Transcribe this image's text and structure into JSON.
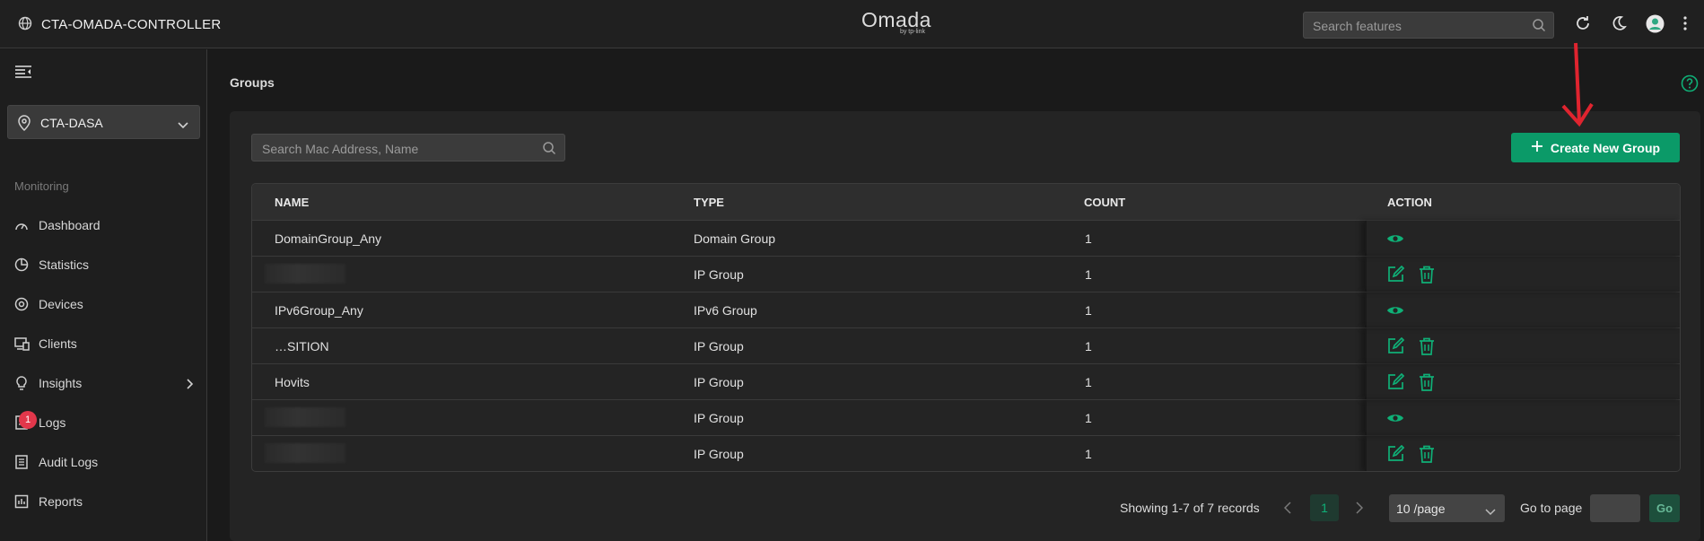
{
  "header": {
    "controller_name": "CTA-OMADA-CONTROLLER",
    "brand": "Omada",
    "brand_sub": "by tp-link",
    "search_placeholder": "Search features"
  },
  "sidebar": {
    "site": "CTA-DASA",
    "section": "Monitoring",
    "items": [
      {
        "label": "Dashboard",
        "icon": "dashboard-icon"
      },
      {
        "label": "Statistics",
        "icon": "pie-chart-icon"
      },
      {
        "label": "Devices",
        "icon": "devices-icon"
      },
      {
        "label": "Clients",
        "icon": "clients-icon"
      },
      {
        "label": "Insights",
        "icon": "lightbulb-icon"
      },
      {
        "label": "Logs",
        "icon": "log-icon",
        "badge": "1"
      },
      {
        "label": "Audit Logs",
        "icon": "audit-log-icon"
      },
      {
        "label": "Reports",
        "icon": "report-icon"
      }
    ]
  },
  "main": {
    "title": "Groups",
    "search_placeholder": "Search Mac Address, Name",
    "create_button": "Create New Group",
    "columns": [
      "NAME",
      "TYPE",
      "COUNT",
      "ACTION"
    ],
    "rows": [
      {
        "name": "DomainGroup_Any",
        "type": "Domain Group",
        "count": "1",
        "actions": [
          "view"
        ]
      },
      {
        "name": "",
        "type": "IP Group",
        "count": "1",
        "actions": [
          "edit",
          "delete"
        ]
      },
      {
        "name": "IPv6Group_Any",
        "type": "IPv6 Group",
        "count": "1",
        "actions": [
          "view"
        ]
      },
      {
        "name": "…SITION",
        "type": "IP Group",
        "count": "1",
        "actions": [
          "edit",
          "delete"
        ]
      },
      {
        "name": "Hovits",
        "type": "IP Group",
        "count": "1",
        "actions": [
          "edit",
          "delete"
        ]
      },
      {
        "name": "",
        "type": "IP Group",
        "count": "1",
        "actions": [
          "view"
        ]
      },
      {
        "name": "",
        "type": "IP Group",
        "count": "1",
        "actions": [
          "edit",
          "delete"
        ]
      }
    ],
    "pagination": {
      "info": "Showing 1-7 of 7 records",
      "current_page": "1",
      "page_size": "10 /page",
      "goto_label": "Go to page",
      "go_button": "Go"
    }
  },
  "colors": {
    "accent": "#0b9a68",
    "badge": "#e2374b",
    "annotation_arrow": "#e0242f"
  }
}
